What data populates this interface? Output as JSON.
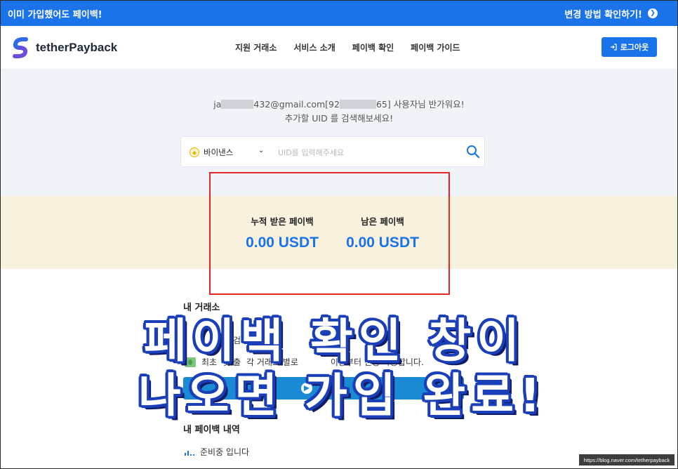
{
  "banner": {
    "left_text": "이미 가입했어도 페이백!",
    "right_text": "변경 방법 확인하기!"
  },
  "header": {
    "brand": "tetherPayback",
    "nav": [
      "지원 거래소",
      "서비스 소개",
      "페이백 확인",
      "페이백 가이드"
    ],
    "logout_label": "로그아웃"
  },
  "search": {
    "greeting_prefix": "ja",
    "greeting_mid": "432@gmail.com[92",
    "greeting_suffix": "65] 사용자님 반가워요!",
    "greeting_line2": "추가할 UID 를 검색해보세요!",
    "exchange": "바이낸스",
    "placeholder": "UID를 입력해주세요"
  },
  "payback": {
    "accumulated_label": "누적 받은 페이백",
    "accumulated_value": "0.00 USDT",
    "remaining_label": "남은 페이백",
    "remaining_value": "0.00 USDT"
  },
  "exchanges": {
    "title": "내 거래소",
    "line1_a": "먼",
    "line1_b": "검색하",
    "line1_c": "세요!",
    "line2_a": "최초",
    "line2_b": "및 출",
    "line2_c": "각 거래소 별로",
    "line2_d": "이상부터 신청 가능합니다."
  },
  "history": {
    "title": "내 페이백 내역",
    "status": "준비중 입니다"
  },
  "overlay": {
    "line1": "페이백 확인 창이",
    "line2": "나오면 가입 완료!"
  },
  "watermark": "https://blog.naver.com/tetherpayback",
  "colors": {
    "primary": "#1a73e8",
    "highlight_box": "#e32626",
    "payback_band": "#f8f1de",
    "search_band": "#f0f4f8"
  }
}
